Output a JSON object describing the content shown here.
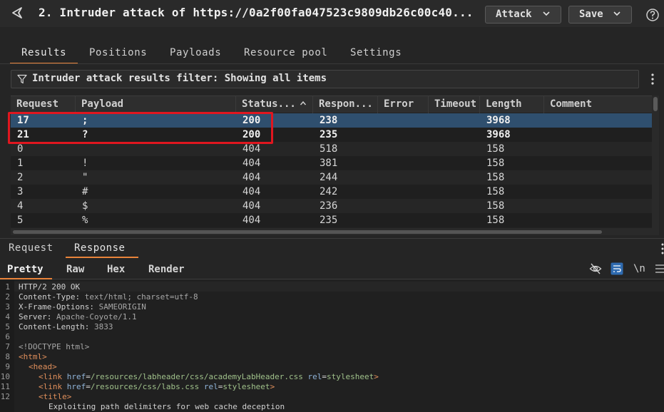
{
  "window": {
    "title": "2. Intruder attack of https://0a2f00fa047523c9809db26c00c40...",
    "attack_label": "Attack",
    "save_label": "Save"
  },
  "main_tabs": [
    {
      "label": "Results"
    },
    {
      "label": "Positions"
    },
    {
      "label": "Payloads"
    },
    {
      "label": "Resource pool"
    },
    {
      "label": "Settings"
    }
  ],
  "filter": {
    "text": "Intruder attack results filter: Showing all items"
  },
  "table": {
    "columns": [
      "Request",
      "Payload",
      "Status...",
      "Respon...",
      "Error",
      "Timeout",
      "Length",
      "Comment"
    ],
    "rows": [
      [
        "17",
        ";",
        "200",
        "238",
        "",
        "",
        "3968",
        ""
      ],
      [
        "21",
        "?",
        "200",
        "235",
        "",
        "",
        "3968",
        ""
      ],
      [
        "0",
        "",
        "404",
        "518",
        "",
        "",
        "158",
        ""
      ],
      [
        "1",
        "!",
        "404",
        "381",
        "",
        "",
        "158",
        ""
      ],
      [
        "2",
        "\"",
        "404",
        "244",
        "",
        "",
        "158",
        ""
      ],
      [
        "3",
        "#",
        "404",
        "242",
        "",
        "",
        "158",
        ""
      ],
      [
        "4",
        "$",
        "404",
        "236",
        "",
        "",
        "158",
        ""
      ],
      [
        "5",
        "%",
        "404",
        "235",
        "",
        "",
        "158",
        ""
      ]
    ]
  },
  "message_tabs": [
    {
      "label": "Request"
    },
    {
      "label": "Response"
    }
  ],
  "view_tabs": [
    {
      "label": "Pretty"
    },
    {
      "label": "Raw"
    },
    {
      "label": "Hex"
    },
    {
      "label": "Render"
    }
  ],
  "newline_toggle": "\\n",
  "response": {
    "line_numbers": [
      "1",
      "2",
      "3",
      "4",
      "5",
      "6",
      "7",
      "8",
      "9",
      "10",
      "11",
      "12",
      ""
    ],
    "l1": "HTTP/2 200 OK",
    "l2_key": "Content-Type:",
    "l2_val": " text/html; charset=utf-8",
    "l3_key": "X-Frame-Options:",
    "l3_val": " SAMEORIGIN",
    "l4_key": "Server:",
    "l4_val": " Apache-Coyote/1.1",
    "l5_key": "Content-Length:",
    "l5_val": " 3833",
    "l7": "<!DOCTYPE html>",
    "l8": "<html>",
    "l9": "<head>",
    "l10_open": "<link",
    "l10_attr1": " href",
    "l10_val1": "/resources/labheader/css/academyLabHeader.css",
    "l10_attr2": " rel",
    "l10_val2": "stylesheet",
    "l10_close": ">",
    "l11_open": "<link",
    "l11_attr1": " href",
    "l11_val1": "/resources/css/labs.css",
    "l11_attr2": " rel",
    "l11_val2": "stylesheet",
    "l11_close": ">",
    "l12": "<title>",
    "l13": "Exploiting path delimiters for web cache deception",
    "eq": "="
  }
}
